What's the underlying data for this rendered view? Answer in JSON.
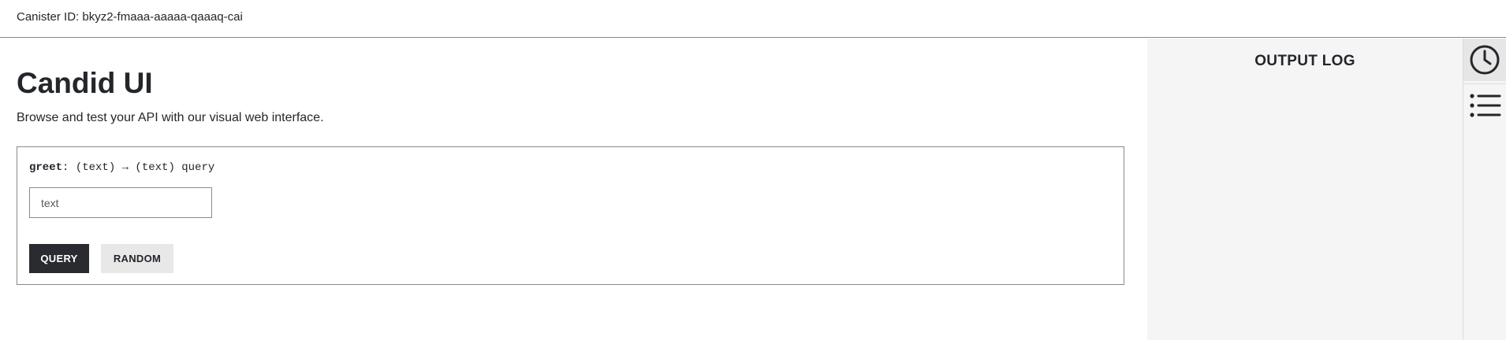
{
  "header": {
    "canister_label": "Canister ID: bkyz2-fmaaa-aaaaa-qaaaq-cai"
  },
  "main": {
    "title": "Candid UI",
    "subtitle": "Browse and test your API with our visual web interface."
  },
  "method": {
    "name": "greet",
    "signature": ": (text) → (text) query",
    "input": {
      "placeholder": "text",
      "value": ""
    },
    "buttons": {
      "query": "QUERY",
      "random": "RANDOM"
    }
  },
  "output_panel": {
    "title": "OUTPUT LOG"
  },
  "side_rail": {
    "items": [
      {
        "icon": "clock-icon",
        "active": true
      },
      {
        "icon": "list-icon",
        "active": false
      }
    ]
  },
  "colors": {
    "primary_button": "#292b30",
    "secondary_button": "#e8e8e8",
    "panel_background": "#f5f5f5",
    "text": "#23262b"
  }
}
